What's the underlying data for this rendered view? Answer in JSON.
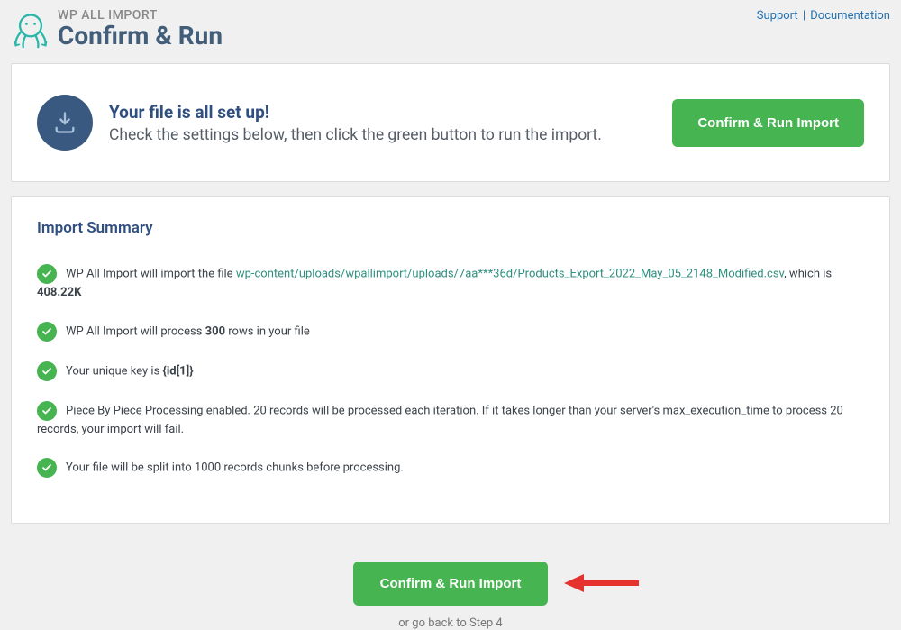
{
  "brand": {
    "label": "WP ALL IMPORT",
    "title": "Confirm & Run"
  },
  "top_links": {
    "support": "Support",
    "documentation": "Documentation"
  },
  "hero": {
    "title": "Your file is all set up!",
    "subtitle": "Check the settings below, then click the green button to run the import.",
    "button": "Confirm & Run Import"
  },
  "summary": {
    "heading": "Import Summary",
    "items": {
      "file": {
        "prefix": "WP All Import will import the file ",
        "path": "wp-content/uploads/wpallimport/uploads/7aa***36d/Products_Export_2022_May_05_2148_Modified.csv",
        "mid": ", which is ",
        "size": "408.22K"
      },
      "rows": {
        "prefix": "WP All Import will process ",
        "count": "300",
        "suffix": " rows in your file"
      },
      "key": {
        "prefix": "Your unique key is ",
        "value": "{id[1]}"
      },
      "piece": "Piece By Piece Processing enabled. 20 records will be processed each iteration. If it takes longer than your server's max_execution_time to process 20 records, your import will fail.",
      "chunks": "Your file will be split into 1000 records chunks before processing."
    }
  },
  "bottom": {
    "button": "Confirm & Run Import",
    "back_prefix": "or go back to ",
    "back_link": "Step 4"
  }
}
